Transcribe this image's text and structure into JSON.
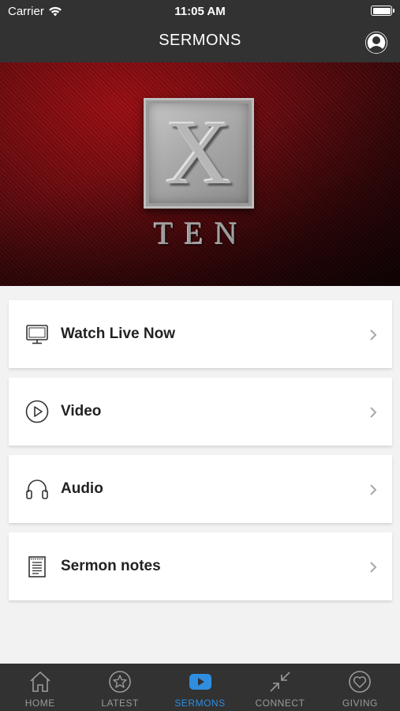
{
  "status_bar": {
    "carrier": "Carrier",
    "time": "11:05 AM",
    "wifi_icon": "wifi-icon",
    "battery_icon": "battery-icon"
  },
  "header": {
    "title": "SERMONS",
    "profile_icon": "user-circle-icon"
  },
  "banner": {
    "letter": "X",
    "word": "TEN"
  },
  "menu": {
    "items": [
      {
        "label": "Watch Live Now",
        "icon": "monitor-icon"
      },
      {
        "label": "Video",
        "icon": "play-circle-icon"
      },
      {
        "label": "Audio",
        "icon": "headphones-icon"
      },
      {
        "label": "Sermon notes",
        "icon": "notepad-icon"
      }
    ]
  },
  "tab_bar": {
    "active": "SERMONS",
    "active_color": "#2f8ee0",
    "inactive_color": "#9a9a9a",
    "items": [
      {
        "label": "HOME",
        "icon": "home-icon"
      },
      {
        "label": "LATEST",
        "icon": "star-circle-icon"
      },
      {
        "label": "SERMONS",
        "icon": "play-rect-icon"
      },
      {
        "label": "CONNECT",
        "icon": "compress-arrows-icon"
      },
      {
        "label": "GIVING",
        "icon": "heart-circle-icon"
      }
    ]
  },
  "colors": {
    "bar_background": "#323232",
    "page_background": "#f2f2f2",
    "banner_red": "#7a0a0f"
  }
}
